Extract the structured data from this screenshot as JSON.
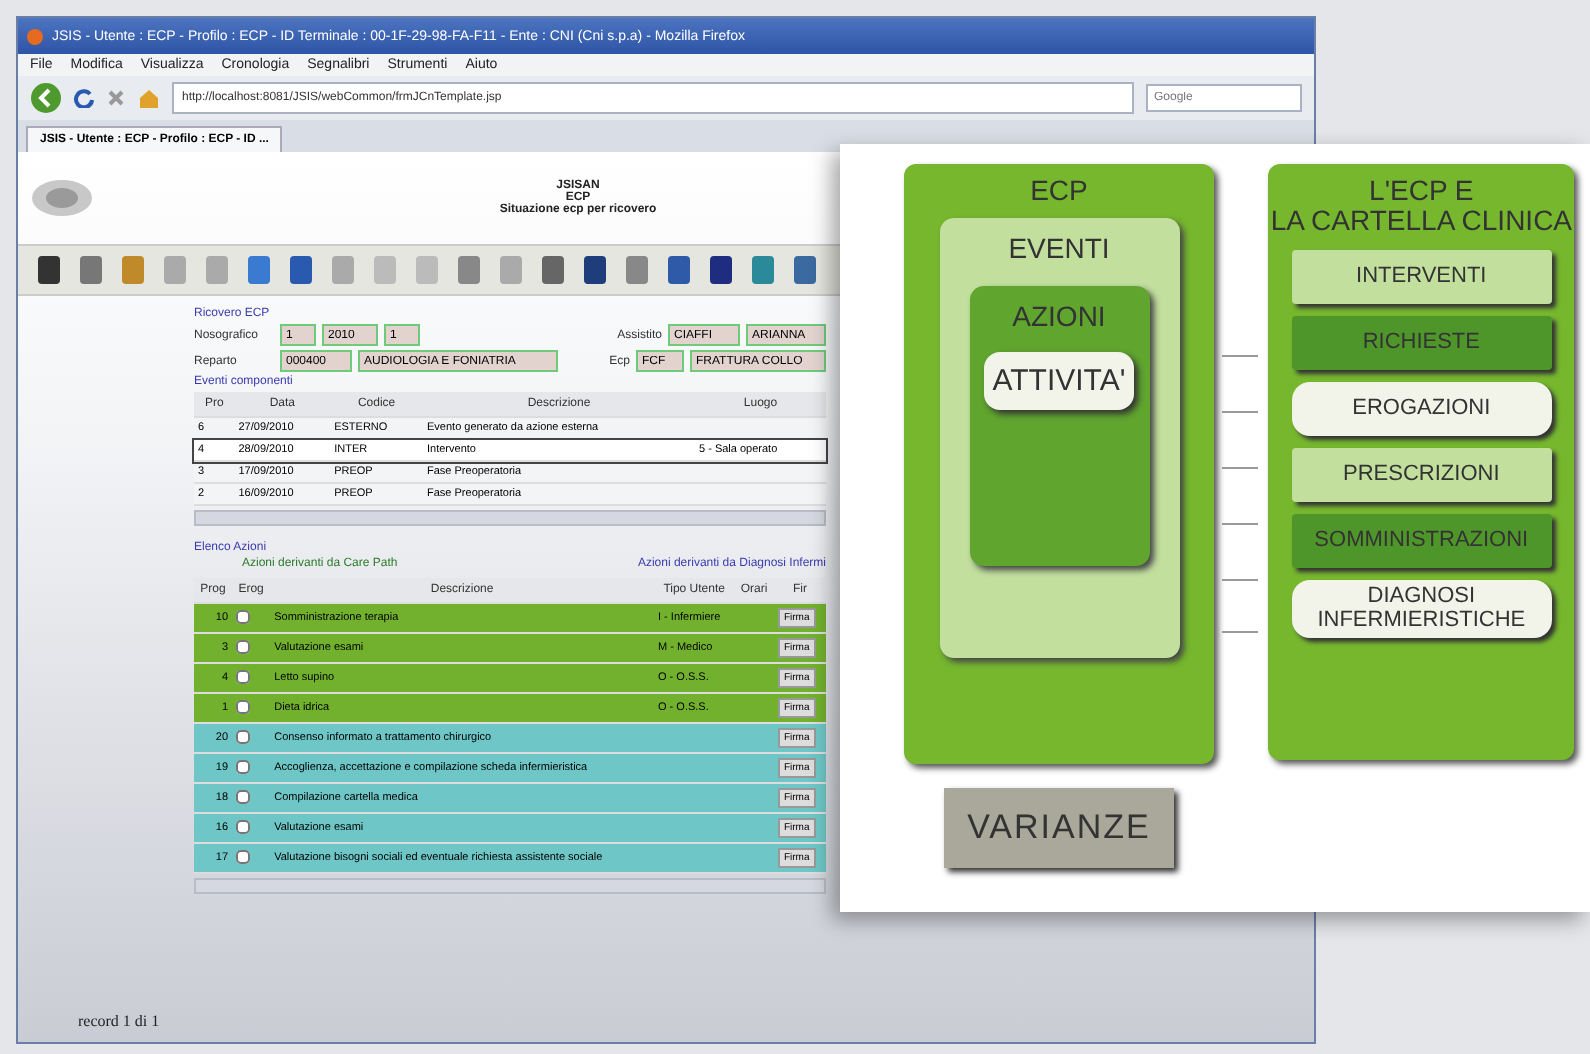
{
  "browser": {
    "title": "JSIS - Utente : ECP - Profilo : ECP - ID Terminale : 00-1F-29-98-FA-F11 - Ente : CNI (Cni s.p.a) - Mozilla Firefox",
    "menu": [
      "File",
      "Modifica",
      "Visualizza",
      "Cronologia",
      "Segnalibri",
      "Strumenti",
      "Aiuto"
    ],
    "url": "http://localhost:8081/JSIS/webCommon/frmJCnTemplate.jsp",
    "search": {
      "placeholder": "Google"
    },
    "tab": "JSIS - Utente : ECP - Profilo : ECP - ID ..."
  },
  "page": {
    "header": [
      "JSISAN",
      "ECP",
      "Situazione ecp per ricovero"
    ],
    "form": {
      "title": "Ricovero ECP",
      "rows": [
        {
          "label": "Nosografico",
          "fields": [
            "1",
            "2010",
            "1"
          ],
          "side_label": "Assistito",
          "side_fields": [
            "CIAFFI",
            "ARIANNA"
          ]
        },
        {
          "label": "Reparto",
          "fields": [
            "000400",
            "AUDIOLOGIA E FONIATRIA"
          ],
          "side_label": "Ecp",
          "side_fields": [
            "FCF",
            "FRATTURA COLLO"
          ]
        }
      ]
    },
    "events": {
      "title": "Eventi componenti",
      "columns": [
        "Pro",
        "Data",
        "Codice",
        "Descrizione",
        "Luogo"
      ],
      "rows": [
        {
          "cells": [
            "6",
            "27/09/2010",
            "ESTERNO",
            "Evento generato da azione esterna"
          ],
          "selected": false
        },
        {
          "cells": [
            "4",
            "28/09/2010",
            "INTER",
            "Intervento",
            "5 - Sala operato"
          ],
          "selected": true
        },
        {
          "cells": [
            "3",
            "17/09/2010",
            "PREOP",
            "Fase Preoperatoria"
          ],
          "selected": false
        },
        {
          "cells": [
            "2",
            "16/09/2010",
            "PREOP",
            "Fase Preoperatoria"
          ],
          "selected": false
        }
      ]
    },
    "actions": {
      "title": "Elenco Azioni",
      "care_path_label": "Azioni derivanti da Care Path",
      "diagnosis_label": "Azioni derivanti da Diagnosi Infermi",
      "columns": [
        "Prog",
        "Erog",
        "Descrizione",
        "Tipo Utente",
        "Orari",
        "Fir"
      ],
      "rows": [
        {
          "prog": "10",
          "checked": false,
          "description": "Somministrazione terapia",
          "user_type": "I - Infermiere",
          "button": "Firma",
          "color": "#72b12e"
        },
        {
          "prog": "3",
          "checked": false,
          "description": "Valutazione esami",
          "user_type": "M - Medico",
          "button": "Firma",
          "color": "#72b12e"
        },
        {
          "prog": "4",
          "checked": false,
          "description": "Letto supino",
          "user_type": "O - O.S.S.",
          "button": "Firma",
          "color": "#72b12e"
        },
        {
          "prog": "1",
          "checked": false,
          "description": "Dieta idrica",
          "user_type": "O - O.S.S.",
          "button": "Firma",
          "color": "#72b12e"
        },
        {
          "prog": "20",
          "checked": false,
          "description": "Consenso informato a trattamento chirurgico",
          "button": "Firma",
          "color": "#6ec6c6"
        },
        {
          "prog": "19",
          "checked": false,
          "description": "Accoglienza, accettazione e compilazione scheda infermieristica",
          "button": "Firma",
          "color": "#6ec6c6"
        },
        {
          "prog": "18",
          "checked": false,
          "description": "Compilazione cartella medica",
          "button": "Firma",
          "color": "#6ec6c6"
        },
        {
          "prog": "16",
          "checked": false,
          "description": "Valutazione esami",
          "button": "Firma",
          "color": "#6ec6c6"
        },
        {
          "prog": "17",
          "checked": false,
          "description": "Valutazione bisogni sociali ed eventuale richiesta assistente sociale",
          "button": "Firma",
          "color": "#6ec6c6"
        }
      ]
    },
    "footer": "record 1 di 1"
  },
  "diagram": {
    "ecp": "ECP",
    "eventi": "EVENTI",
    "azioni": "AZIONI",
    "attivita": "ATTIVITA'",
    "varianze": "VARIANZE",
    "record_title": [
      "L'ECP E",
      "LA CARTELLA CLINICA"
    ],
    "items": [
      {
        "label": "INTERVENTI",
        "kind": "light"
      },
      {
        "label": "RICHIESTE",
        "kind": "dark"
      },
      {
        "label": "EROGAZIONI",
        "kind": "pale"
      },
      {
        "label": "PRESCRIZIONI",
        "kind": "light"
      },
      {
        "label": "SOMMINISTRAZIONI",
        "kind": "dark"
      },
      {
        "label": "DIAGNOSI INFERMIERISTICHE",
        "kind": "pale"
      }
    ]
  }
}
